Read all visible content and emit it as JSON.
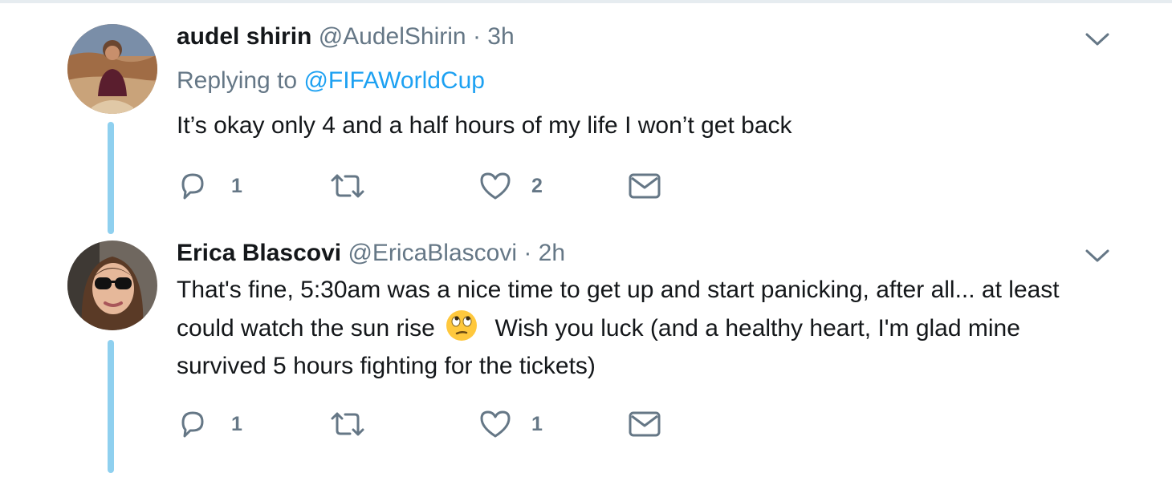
{
  "tweets": [
    {
      "fullname": "audel shirin",
      "handle": "@AudelShirin",
      "separator": "·",
      "time": "3h",
      "replying_prefix": "Replying to",
      "replying_to": "@FIFAWorldCup",
      "text": "It’s okay only 4 and a half hours of my life I won’t get back",
      "reply_count": "1",
      "retweet_count": "",
      "like_count": "2"
    },
    {
      "fullname": "Erica Blascovi",
      "handle": "@EricaBlascovi",
      "separator": "·",
      "time": "2h",
      "text_part1": "That's fine, 5:30am was a nice time to get up and start panicking, after all... at least could watch the sun rise",
      "text_part2": "Wish you luck (and a healthy heart, I'm glad mine survived 5 hours fighting for the tickets)",
      "emoji": "rolling-eyes-emoji",
      "reply_count": "1",
      "retweet_count": "",
      "like_count": "1"
    }
  ],
  "colors": {
    "text": "#14171a",
    "secondary": "#657786",
    "link": "#1da1f2",
    "thread_line": "#8fd0ef",
    "divider": "#e6ecf0"
  },
  "icons": [
    "reply-icon",
    "retweet-icon",
    "like-icon",
    "direct-message-icon",
    "chevron-down-icon"
  ]
}
